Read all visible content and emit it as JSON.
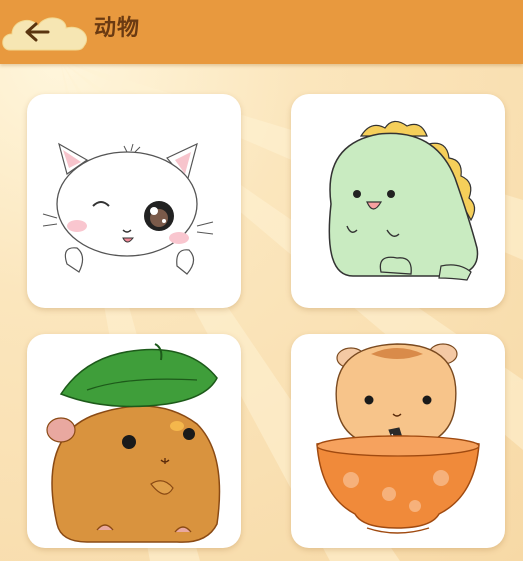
{
  "header": {
    "title": "动物",
    "back_icon": "arrow-left-icon",
    "color": "#e8993e"
  },
  "cards": [
    {
      "icon": "cat-icon"
    },
    {
      "icon": "dinosaur-icon"
    },
    {
      "icon": "hamster-leaf-icon"
    },
    {
      "icon": "hamster-bowl-icon"
    }
  ]
}
